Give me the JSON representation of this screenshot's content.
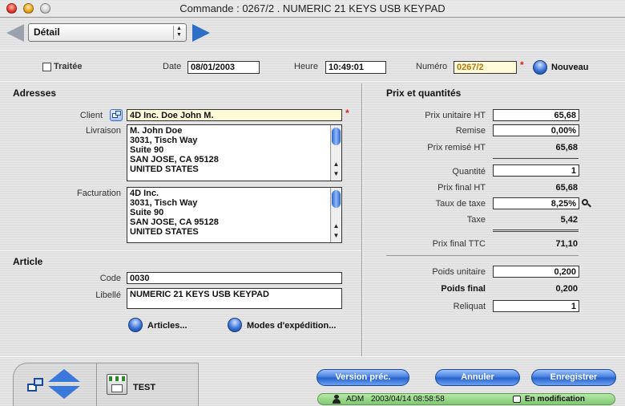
{
  "window": {
    "title": "Commande : 0267/2 . NUMERIC 21 KEYS USB KEYPAD"
  },
  "nav": {
    "view_selected": "Détail"
  },
  "header": {
    "traitee_label": "Traitée",
    "date_label": "Date",
    "date_value": "08/01/2003",
    "heure_label": "Heure",
    "heure_value": "10:49:01",
    "numero_label": "Numéro",
    "numero_value": "0267/2",
    "nouveau_label": "Nouveau"
  },
  "addresses": {
    "section_title": "Adresses",
    "client_label": "Client",
    "client_value": "4D Inc.  Doe John M.",
    "livraison_label": "Livraison",
    "livraison_lines": [
      "M. John Doe",
      "3031, Tisch Way",
      "Suite 90",
      "SAN JOSE, CA 95128",
      "UNITED STATES"
    ],
    "facturation_label": "Facturation",
    "facturation_lines": [
      "4D Inc.",
      "3031, Tisch Way",
      "Suite 90",
      "SAN JOSE, CA 95128",
      "UNITED STATES"
    ]
  },
  "article": {
    "section_title": "Article",
    "code_label": "Code",
    "code_value": "0030",
    "libelle_label": "Libellé",
    "libelle_value": "NUMERIC 21 KEYS USB KEYPAD",
    "articles_button": "Articles...",
    "modes_button": "Modes d'expédition..."
  },
  "prices": {
    "section_title": "Prix et quantités",
    "prix_unitaire_ht_label": "Prix unitaire HT",
    "prix_unitaire_ht_value": "65,68",
    "remise_label": "Remise",
    "remise_value": "0,00%",
    "prix_remise_ht_label": "Prix remisé HT",
    "prix_remise_ht_value": "65,68",
    "quantite_label": "Quantité",
    "quantite_value": "1",
    "prix_final_ht_label": "Prix final HT",
    "prix_final_ht_value": "65,68",
    "taux_taxe_label": "Taux de taxe",
    "taux_taxe_value": "8,25%",
    "taxe_label": "Taxe",
    "taxe_value": "5,42",
    "prix_final_ttc_label": "Prix final TTC",
    "prix_final_ttc_value": "71,10",
    "poids_unitaire_label": "Poids unitaire",
    "poids_unitaire_value": "0,200",
    "poids_final_label": "Poids final",
    "poids_final_value": "0,200",
    "reliquat_label": "Reliquat",
    "reliquat_value": "1"
  },
  "footer": {
    "module_label": "TEST",
    "version_prec_button": "Version préc.",
    "annuler_button": "Annuler",
    "enregistrer_button": "Enregistrer",
    "status_user": "ADM",
    "status_timestamp": "2003/04/14  08:58:58",
    "status_mode": "En modification"
  },
  "colors": {
    "accent_blue": "#2f6ec7",
    "required_star": "#dd2222",
    "numero_text": "#b4780a",
    "status_green": "#80c871"
  }
}
